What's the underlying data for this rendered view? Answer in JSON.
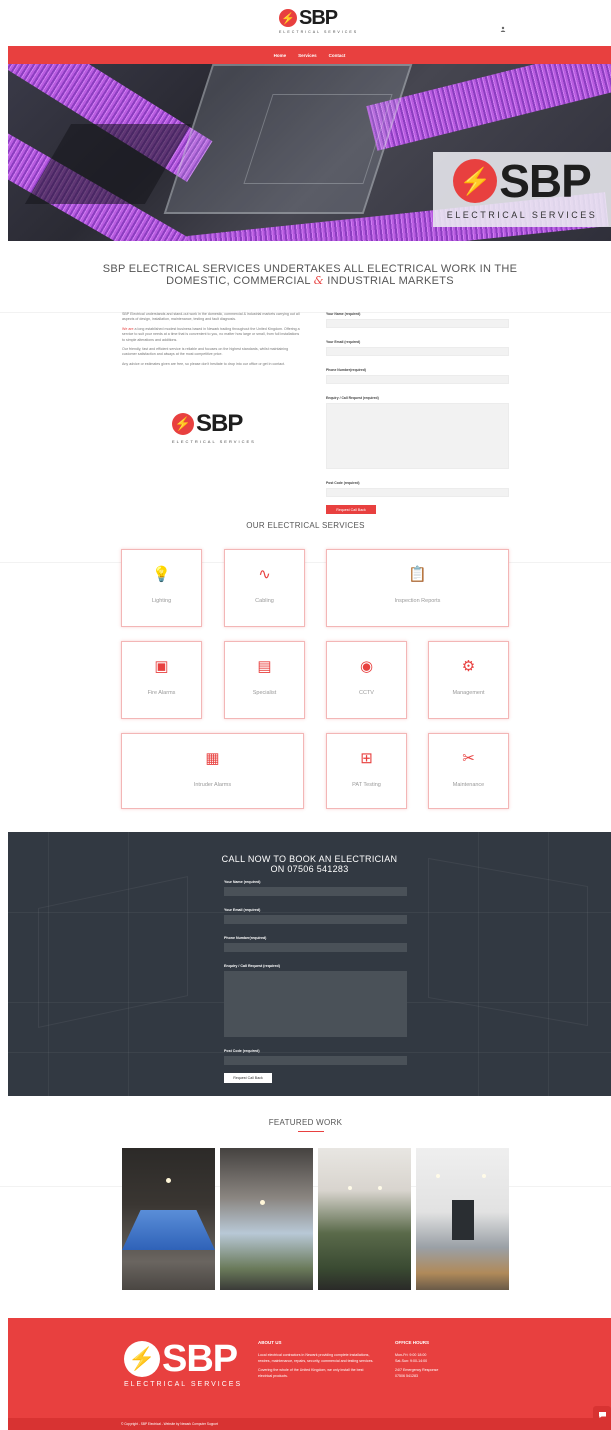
{
  "header": {
    "logo_text": "SBP",
    "logo_subtitle": "ELECTRICAL SERVICES",
    "account_icon": "user-icon"
  },
  "nav": {
    "items": [
      {
        "label": "Home"
      },
      {
        "label": "Services"
      },
      {
        "label": "Contact"
      }
    ]
  },
  "hero": {
    "badge_text": "SBP",
    "badge_subtitle": "ELECTRICAL SERVICES"
  },
  "tagline": {
    "line1": "SBP ELECTRICAL SERVICES UNDERTAKES ALL ELECTRICAL WORK IN THE",
    "line2a": "DOMESTIC, COMMERCIAL",
    "amp": "&",
    "line2b": "INDUSTRIAL MARKETS"
  },
  "intro": {
    "p1": "SBP Electrical understands and stand-out work in the domestic, commercial & industrial markets carrying out all aspects of design, installation, maintenance, testing and fault diagnosis.",
    "p2_lead": "We are",
    "p2": "a long established modest business based in Newark trading throughout the United Kingdom. Offering a service to suit your needs at a time that is convenient to you, no matter how large or small, from full installations to simple alterations and additions.",
    "p3": "Our friendly, fast and efficient service is reliable and focuses on the highest standards, whilst maintaining customer satisfaction and always at the most competitive price.",
    "p4": "Any advice or estimates given are free, so please don't hesitate to drop into our office or get in contact.",
    "logo_text": "SBP",
    "logo_subtitle": "ELECTRICAL SERVICES"
  },
  "contact_form": {
    "name_label": "Your Name (required)",
    "email_label": "Your Email (required)",
    "phone_label": "Phone Number(required)",
    "enquiry_label": "Enquiry / Call Request (required)",
    "postcode_label": "Post Code (required)",
    "submit": "Request Call Back"
  },
  "services": {
    "title": "OUR ELECTRICAL SERVICES",
    "items": [
      {
        "label": "Lighting",
        "icon": "lightbulb-icon"
      },
      {
        "label": "Cabling",
        "icon": "cable-icon"
      },
      {
        "label": "Inspection Reports",
        "icon": "clipboard-icon"
      },
      {
        "label": "Fire Alarms",
        "icon": "fire-alarm-icon"
      },
      {
        "label": "Specialist",
        "icon": "panel-icon"
      },
      {
        "label": "CCTV",
        "icon": "camera-icon"
      },
      {
        "label": "Management",
        "icon": "management-icon"
      },
      {
        "label": "Intruder Alarms",
        "icon": "keypad-icon"
      },
      {
        "label": "PAT Testing",
        "icon": "tester-icon"
      },
      {
        "label": "Maintenance",
        "icon": "tools-icon"
      }
    ]
  },
  "cta": {
    "title1": "CALL NOW TO BOOK AN ELECTRICIAN",
    "title2": "ON 07506 541283",
    "name_label": "Your Name (required)",
    "email_label": "Your Email (required)",
    "phone_label": "Phone Number(required)",
    "enquiry_label": "Enquiry / Call Request (required)",
    "postcode_label": "Post Code (required)",
    "submit": "Request Call Back"
  },
  "featured": {
    "title": "FEATURED WORK"
  },
  "footer": {
    "logo_text": "SBP",
    "logo_subtitle": "ELECTRICAL SERVICES",
    "about_title": "ABOUT US",
    "about_p1": "Local electrical contractors in Newark providing complete installations, rewires, maintenance, repairs, security, commercial and testing services.",
    "about_p2": "Covering the whole of the United Kingdom, we only install the best electrical products.",
    "hours_title": "OFFICE HOURS",
    "hours_1": "Mon-Fri: 9:00 18:00",
    "hours_2": "Sat-Sun: 9:00-14:00",
    "hours_3": "24/7 Emergency Response",
    "hours_4": "07506 541283",
    "copyright": "© Copyright - SBP Electrical - Website by Newark Computer Support",
    "chat_icon": "chat-icon"
  },
  "colors": {
    "brand_red": "#e8403f",
    "dark_section": "#323942"
  }
}
